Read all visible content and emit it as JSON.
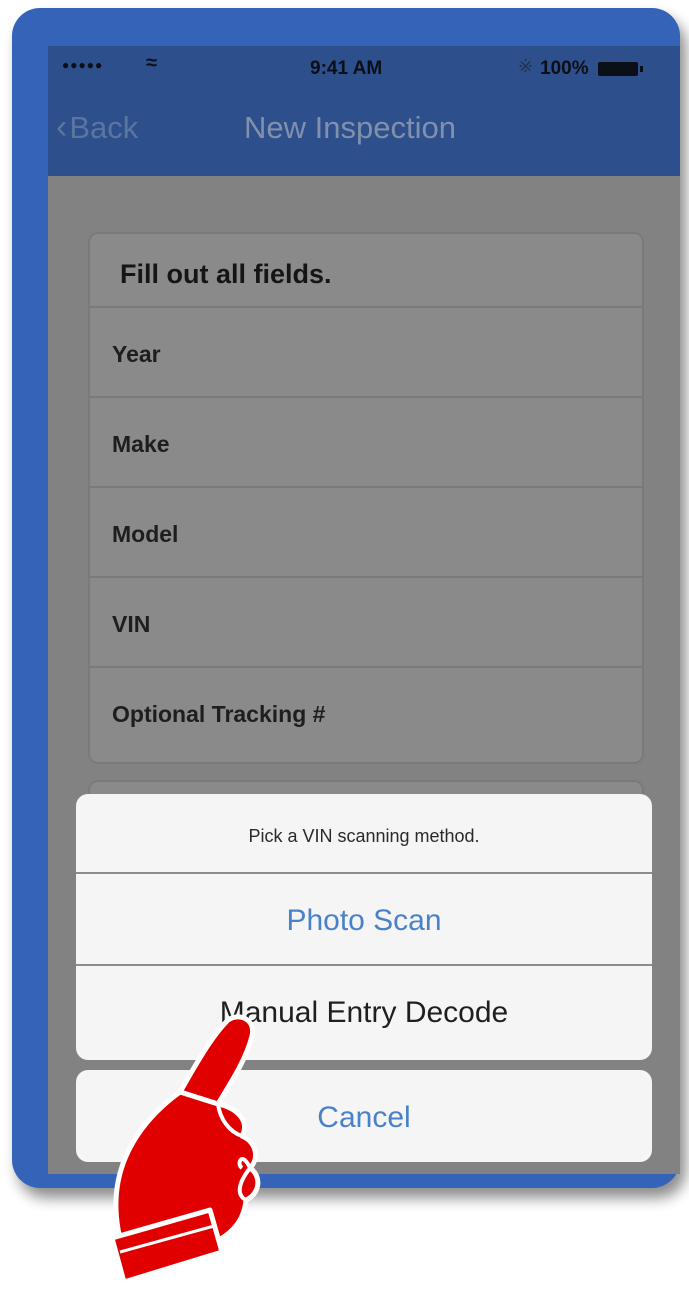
{
  "status_bar": {
    "signal": "●●●●●",
    "time": "9:41 AM",
    "battery": "100%"
  },
  "nav": {
    "back_label": "Back",
    "title": "New Inspection"
  },
  "form": {
    "header": "Fill out all fields.",
    "fields": [
      "Year",
      "Make",
      "Model",
      "VIN",
      "Optional Tracking #"
    ]
  },
  "action_sheet": {
    "title": "Pick a VIN scanning method.",
    "options": [
      "Photo Scan",
      "Manual Entry Decode"
    ],
    "cancel": "Cancel"
  },
  "icons": {
    "wifi": "wifi-icon",
    "bluetooth": "bluetooth-icon",
    "battery": "battery-icon",
    "back": "chevron-left-icon",
    "overlay": "pointing-hand-icon"
  },
  "colors": {
    "frame": "#3563b8",
    "navbar": "#2d4f8b",
    "accent": "#4a82c9",
    "hand": "#e10000"
  }
}
